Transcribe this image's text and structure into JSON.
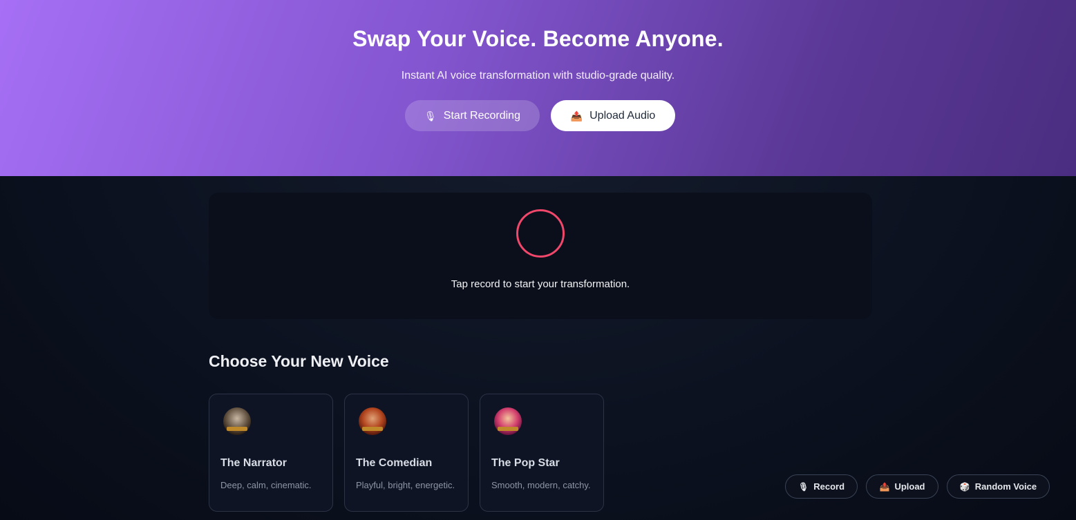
{
  "hero": {
    "title": "Swap Your Voice. Become Anyone.",
    "subtitle": "Instant AI voice transformation with studio-grade quality.",
    "record_button": {
      "icon": "🎙",
      "label": "Start Recording"
    },
    "upload_button": {
      "icon": "📤",
      "label": "Upload Audio"
    }
  },
  "recorder": {
    "hint": "Tap record to start your transformation.",
    "accent_color": "#f0476b"
  },
  "voices": {
    "title": "Choose Your New Voice",
    "items": [
      {
        "name": "The Narrator",
        "description": "Deep, calm, cinematic."
      },
      {
        "name": "The Comedian",
        "description": "Playful, bright, energetic."
      },
      {
        "name": "The Pop Star",
        "description": "Smooth, modern, catchy."
      }
    ]
  },
  "quick_actions": {
    "record": {
      "icon": "🎙",
      "label": "Record"
    },
    "upload": {
      "icon": "📤",
      "label": "Upload"
    },
    "random": {
      "icon": "🎲",
      "label": "Random Voice"
    }
  }
}
